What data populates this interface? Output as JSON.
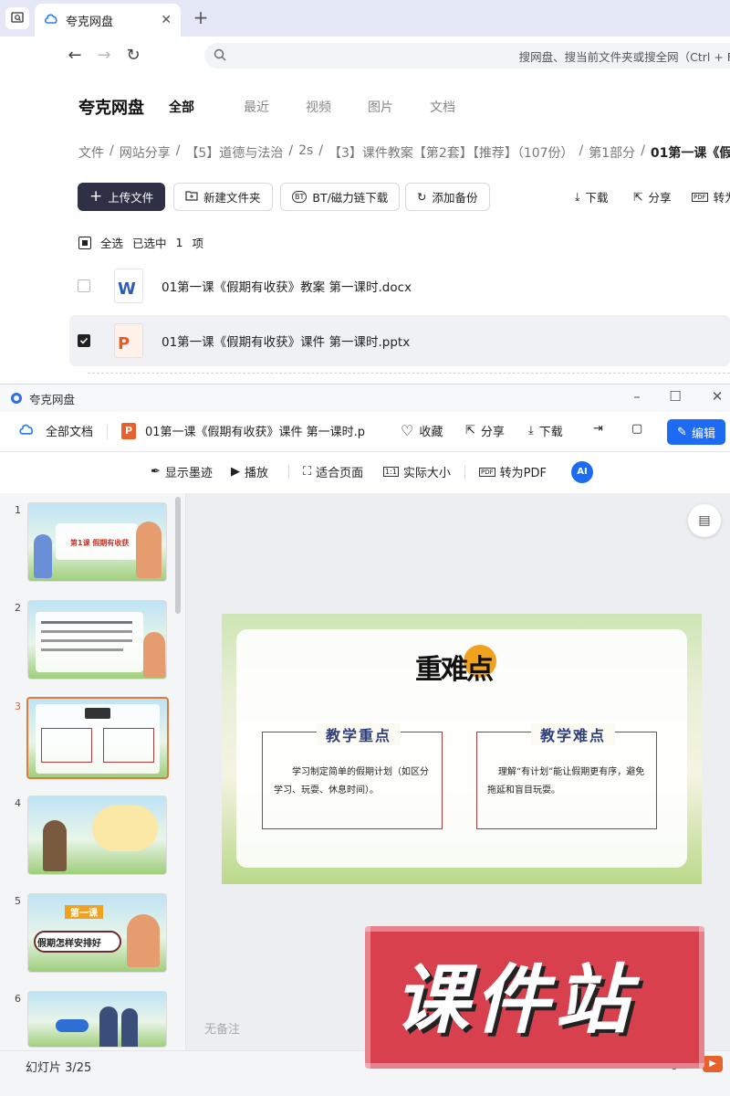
{
  "browser": {
    "tab_title": "夸克网盘",
    "url_placeholder": "搜网盘、搜当前文件夹或搜全网（Ctrl + F"
  },
  "app": {
    "brand": "夸克网盘",
    "nav_tabs": [
      "全部",
      "最近",
      "视频",
      "图片",
      "文档"
    ],
    "breadcrumb": [
      "文件",
      "网站分享",
      "【5】道德与法治",
      "2s",
      "【3】课件教案【第2套】【推荐】（107份）",
      "第1部分",
      "01第一课《假"
    ],
    "buttons": {
      "upload": "上传文件",
      "new_folder": "新建文件夹",
      "bt": "BT/磁力链下载",
      "backup": "添加备份",
      "download": "下载",
      "share": "分享",
      "convert": "转为"
    },
    "selection": {
      "select_all": "全选",
      "selected_prefix": "已选中",
      "selected_count": "1",
      "selected_unit": "项"
    },
    "files": [
      {
        "name": "01第一课《假期有收获》教案 第一课时.docx",
        "icon": "W",
        "selected": false
      },
      {
        "name": "01第一课《假期有收获》课件 第一课时.pptx",
        "icon": "P",
        "selected": true
      }
    ]
  },
  "viewer": {
    "window_title": "夸克网盘",
    "all_docs": "全部文档",
    "doc_title": "01第一课《假期有收获》课件 第一课时.p",
    "fav": "收藏",
    "share": "分享",
    "download": "下载",
    "edit": "编辑",
    "sub_tools": {
      "ink": "显示墨迹",
      "play": "播放",
      "fit": "适合页面",
      "actual": "实际大小",
      "pdf": "转为PDF"
    },
    "ai_label": "AI",
    "thumb_numbers": [
      "1",
      "2",
      "3",
      "4",
      "5",
      "6"
    ],
    "thumbs": {
      "t1_caption": "第1课 假期有收获",
      "t5_caption": "假期怎样安排好",
      "t5_banner": "第一课"
    },
    "slide": {
      "logo": "重难点",
      "left_head": "教学重点",
      "left_text": "学习制定简单的假期计划（如区分学习、玩耍、休息时间）。",
      "right_head": "教学难点",
      "right_text": "理解“有计划”能让假期更有序，避免拖延和盲目玩耍。"
    },
    "notes": "无备注",
    "status": "幻灯片 3/25",
    "watermark": "课件站"
  }
}
